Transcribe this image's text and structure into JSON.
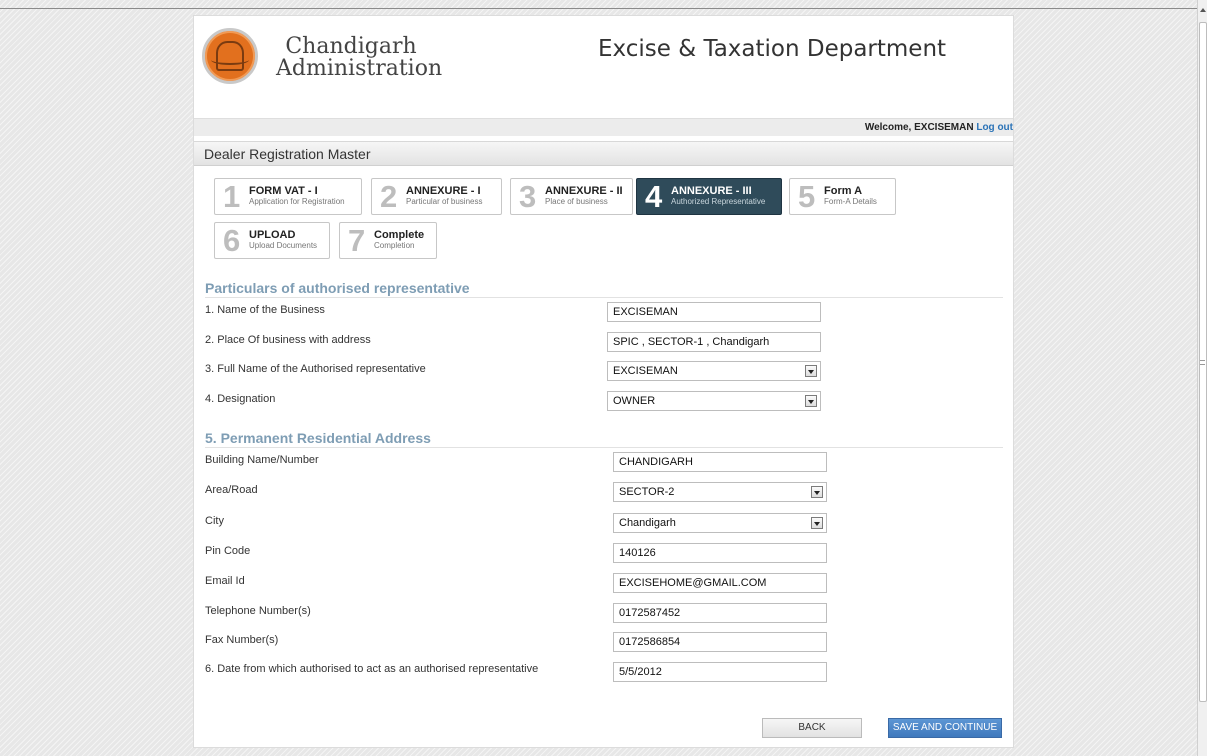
{
  "header": {
    "brand_line1": "Chandigarh",
    "brand_line2": "Administration",
    "department": "Excise & Taxation Department"
  },
  "user_bar": {
    "welcome": "Welcome, EXCISEMAN",
    "logout": "Log out"
  },
  "page_title": "Dealer Registration Master",
  "steps": [
    {
      "num": "1",
      "title": "FORM VAT - I",
      "subtitle": "Application for Registration"
    },
    {
      "num": "2",
      "title": "ANNEXURE - I",
      "subtitle": "Particular of business"
    },
    {
      "num": "3",
      "title": "ANNEXURE - II",
      "subtitle": "Place of business"
    },
    {
      "num": "4",
      "title": "ANNEXURE - III",
      "subtitle": "Authorized Representative"
    },
    {
      "num": "5",
      "title": "Form A",
      "subtitle": "Form-A Details"
    },
    {
      "num": "6",
      "title": "UPLOAD",
      "subtitle": "Upload Documents"
    },
    {
      "num": "7",
      "title": "Complete",
      "subtitle": "Completion"
    }
  ],
  "active_step": "4",
  "section1": {
    "title": "Particulars of authorised representative",
    "fields": [
      {
        "label": "1. Name of the Business",
        "value": "EXCISEMAN"
      },
      {
        "label": "2. Place Of business with address",
        "value": "SPIC , SECTOR-1 , Chandigarh"
      },
      {
        "label": "3. Full Name of the Authorised representative",
        "value": "EXCISEMAN"
      },
      {
        "label": "4. Designation",
        "value": "OWNER"
      }
    ]
  },
  "section2": {
    "title": "5. Permanent Residential Address",
    "fields": [
      {
        "label": "Building Name/Number",
        "value": "CHANDIGARH"
      },
      {
        "label": "Area/Road",
        "value": "SECTOR-2"
      },
      {
        "label": "City",
        "value": "Chandigarh"
      },
      {
        "label": "Pin Code",
        "value": "140126"
      },
      {
        "label": "Email Id",
        "value": "EXCISEHOME@GMAIL.COM"
      },
      {
        "label": "Telephone Number(s)",
        "value": "0172587452"
      },
      {
        "label": "Fax Number(s)",
        "value": "0172586854"
      },
      {
        "label": "6. Date from which authorised to act as an authorised representative",
        "value": "5/5/2012"
      }
    ]
  },
  "buttons": {
    "back": "BACK",
    "save": "SAVE AND CONTINUE"
  },
  "colors": {
    "active_step_bg": "#2f4b5a",
    "section_title": "#7e9db4",
    "logout_link": "#2b73b7",
    "save_button": "#4a86c8",
    "logo_orange": "#e2701e"
  }
}
